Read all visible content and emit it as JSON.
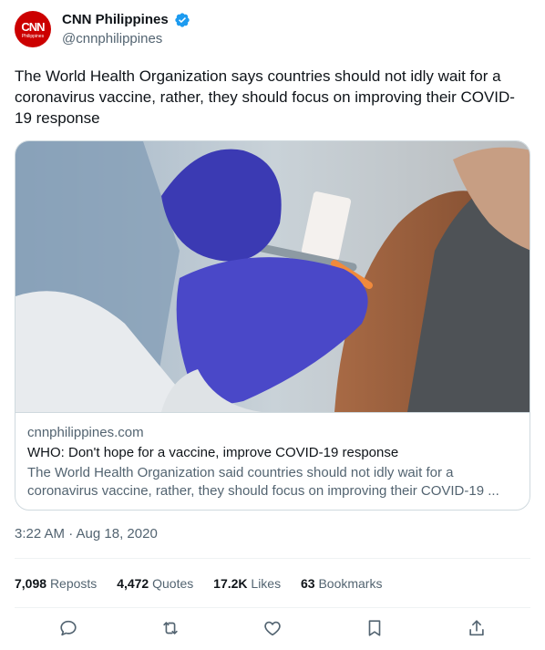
{
  "author": {
    "avatar_text": "CNN",
    "avatar_subtext": "Philippines",
    "display_name": "CNN Philippines",
    "handle": "@cnnphilippines",
    "verified_icon": "verified-badge-icon"
  },
  "tweet": {
    "text": "The World Health Organization says countries should not idly wait for a coronavirus vaccine, rather, they should focus on improving their COVID-19 response",
    "timestamp": "3:22 AM · Aug 18, 2020"
  },
  "card": {
    "image_icon": "vaccination-photo",
    "domain": "cnnphilippines.com",
    "title": "WHO: Don't hope for a vaccine, improve COVID-19 response",
    "description": "The World Health Organization said countries should not idly wait for a coronavirus vaccine, rather, they should focus on improving their COVID-19 ..."
  },
  "stats": {
    "reposts": {
      "num": "7,098",
      "label": "Reposts"
    },
    "quotes": {
      "num": "4,472",
      "label": "Quotes"
    },
    "likes": {
      "num": "17.2K",
      "label": "Likes"
    },
    "bookmarks": {
      "num": "63",
      "label": "Bookmarks"
    }
  },
  "actions": [
    "reply-icon",
    "repost-icon",
    "like-icon",
    "bookmark-icon",
    "share-icon"
  ],
  "colors": {
    "accent": "#1d9bf0",
    "avatar": "#cc0000",
    "muted": "#536471"
  }
}
